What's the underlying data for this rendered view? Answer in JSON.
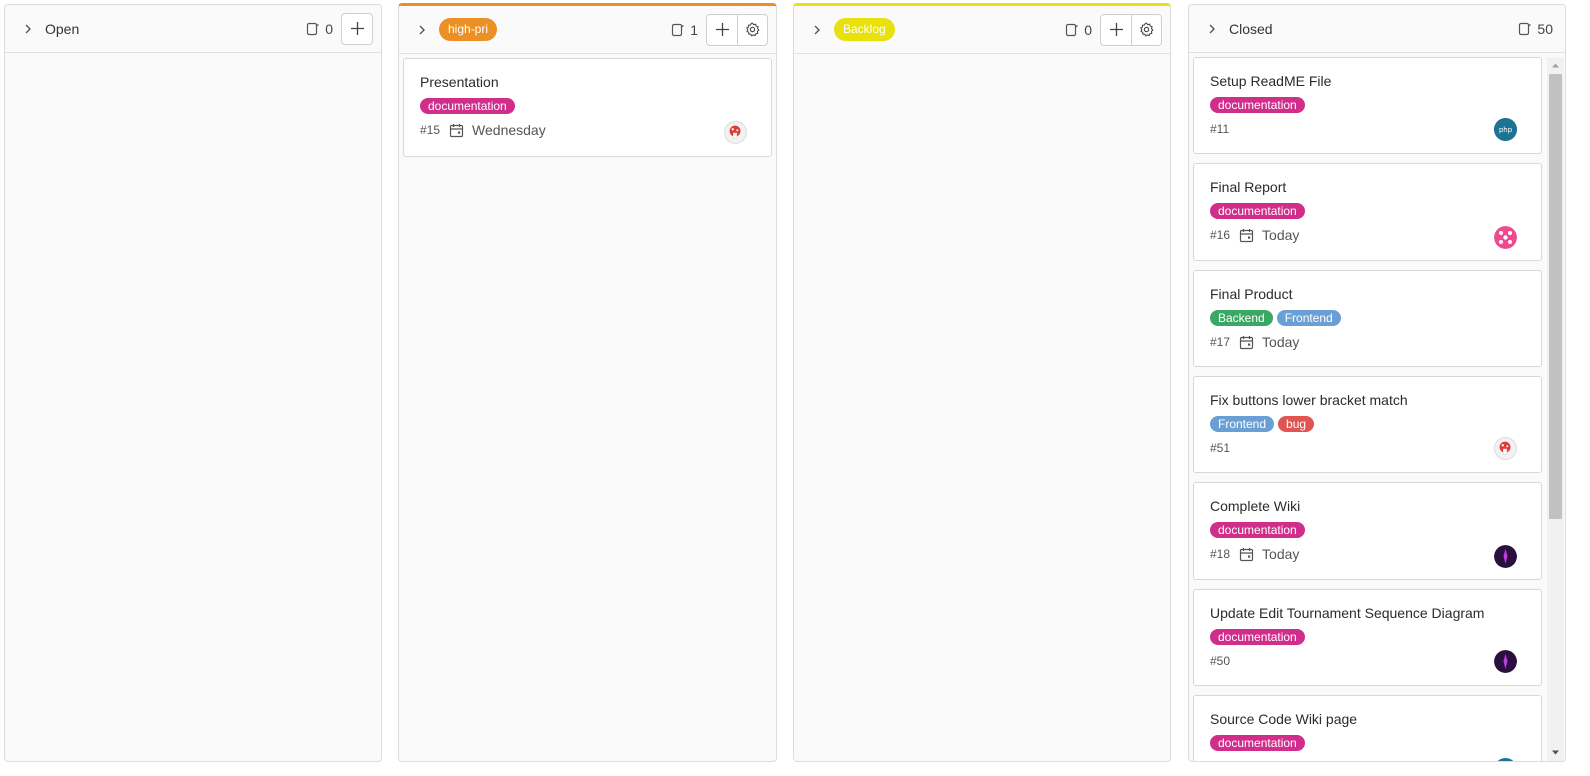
{
  "colors": {
    "high_pri": "#ec8f24",
    "backlog": "#e8e10c",
    "documentation": "#d12e8c",
    "backend": "#3aa865",
    "frontend": "#6a9fd6",
    "bug": "#e05451"
  },
  "columns": {
    "open": {
      "title": "Open",
      "count": "0"
    },
    "high_pri": {
      "label": "high-pri",
      "count": "1",
      "cards": [
        {
          "title": "Presentation",
          "labels": [
            "documentation"
          ],
          "number": "#15",
          "due": "Wednesday"
        }
      ]
    },
    "backlog": {
      "label": "Backlog",
      "count": "0"
    },
    "closed": {
      "title": "Closed",
      "count": "50",
      "cards": [
        {
          "title": "Setup ReadME File",
          "labels": [
            "documentation"
          ],
          "number": "#11",
          "due": ""
        },
        {
          "title": "Final Report",
          "labels": [
            "documentation"
          ],
          "number": "#16",
          "due": "Today"
        },
        {
          "title": "Final Product",
          "labels": [
            "Backend",
            "Frontend"
          ],
          "number": "#17",
          "due": "Today"
        },
        {
          "title": "Fix buttons lower bracket match",
          "labels": [
            "Frontend",
            "bug"
          ],
          "number": "#51",
          "due": ""
        },
        {
          "title": "Complete Wiki",
          "labels": [
            "documentation"
          ],
          "number": "#18",
          "due": "Today"
        },
        {
          "title": "Update Edit Tournament Sequence Diagram",
          "labels": [
            "documentation"
          ],
          "number": "#50",
          "due": ""
        },
        {
          "title": "Source Code Wiki page",
          "labels": [
            "documentation"
          ],
          "number": "",
          "due": ""
        }
      ]
    }
  },
  "icons": {
    "expand": "chevron-right-icon",
    "issue_count": "issue-count-icon",
    "add": "plus-icon",
    "settings": "gear-icon",
    "due_date": "calendar-icon"
  }
}
